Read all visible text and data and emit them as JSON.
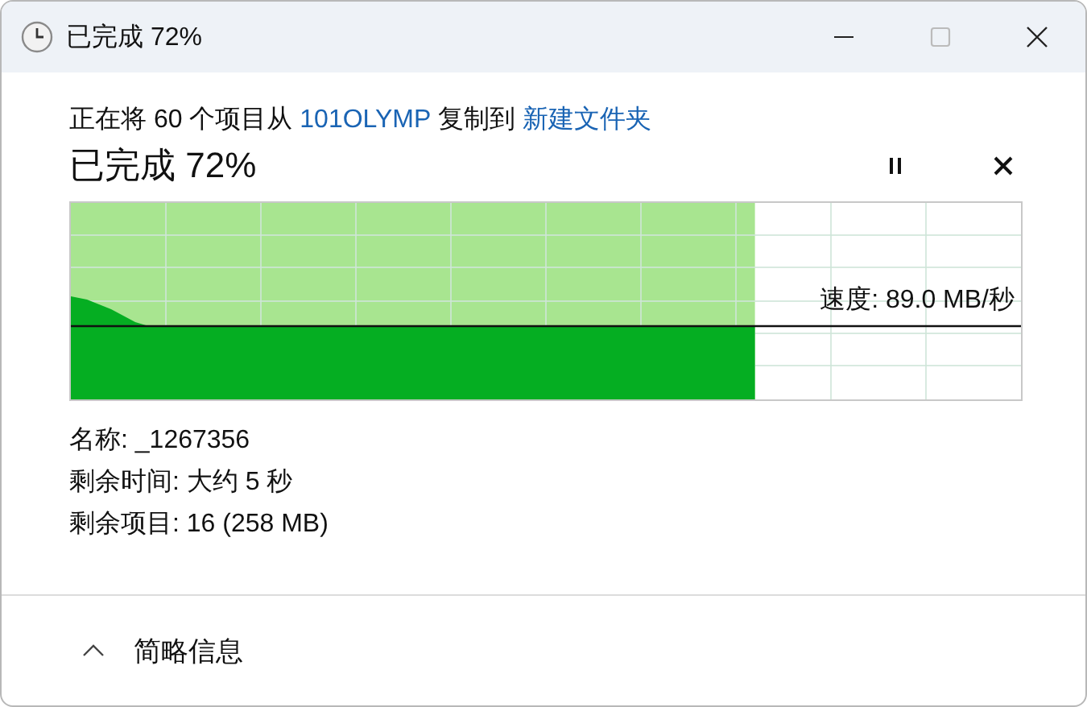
{
  "window": {
    "title": "已完成 72%"
  },
  "copy_line": [
    {
      "kind": "text",
      "text": "正在将 60 个项目从 "
    },
    {
      "kind": "link",
      "text": "101OLYMP"
    },
    {
      "kind": "text",
      "text": " 复制到 "
    },
    {
      "kind": "link",
      "text": "新建文件夹"
    }
  ],
  "progress": {
    "heading": "已完成 72%",
    "level": 0.72,
    "speed": "速度: 89.0 MB/秒"
  },
  "details": [
    "名称: _1267356",
    "剩余时间: 大约 5 秒",
    "剩余项目: 16 (258 MB)"
  ],
  "footer": {
    "toggle": "简略信息"
  }
}
